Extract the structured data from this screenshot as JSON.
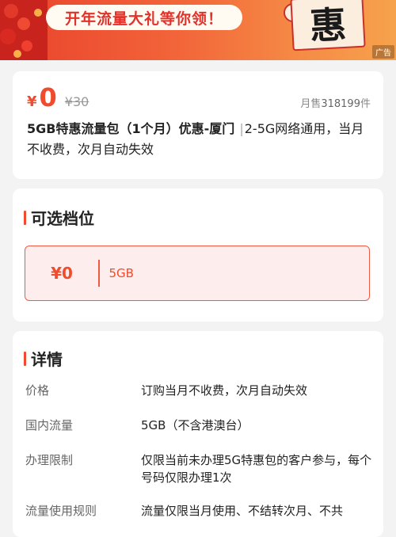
{
  "banner": {
    "text": "开年流量大礼等你领！",
    "scroll_char": "惠",
    "ad_label": "广告"
  },
  "product": {
    "currency": "¥",
    "price": "0",
    "original_price": "¥30",
    "monthly_sales_prefix": "月售",
    "monthly_sales_count": "318199",
    "monthly_sales_suffix": "件",
    "title_name": "5GB特惠流量包（1个月）优惠-厦门",
    "title_separator": "|",
    "title_desc": "2-5G网络通用，当月不收费，次月自动失效"
  },
  "tiers": {
    "title": "可选档位",
    "options": [
      {
        "price": "¥0",
        "size": "5GB"
      }
    ]
  },
  "details": {
    "title": "详情",
    "rows": [
      {
        "label": "价格",
        "value": "订购当月不收费，次月自动失效"
      },
      {
        "label": "国内流量",
        "value": "5GB（不含港澳台）"
      },
      {
        "label": "办理限制",
        "value": "仅限当前未办理5G特惠包的客户参与，每个号码仅限办理1次"
      },
      {
        "label": "流量使用规则",
        "value": "流量仅限当月使用、不结转次月、不共"
      }
    ]
  },
  "colors": {
    "accent": "#ef4b2c",
    "banner_start": "#e9412b",
    "banner_end": "#f6a24c",
    "tier_bg": "#fdeeed"
  }
}
